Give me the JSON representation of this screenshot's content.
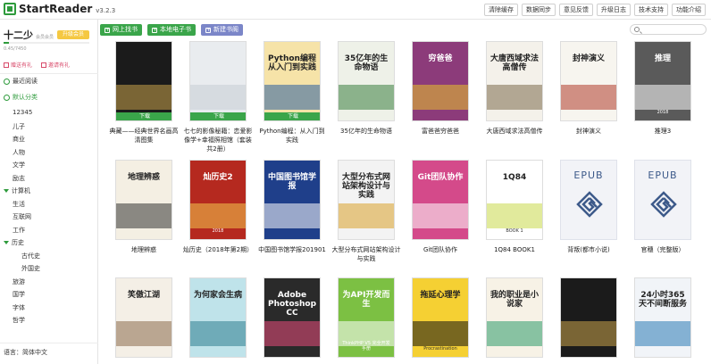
{
  "app": {
    "name": "StartReader",
    "version": "v3.2.3"
  },
  "top_actions": [
    "清除缓存",
    "数据同步",
    "意见反馈",
    "升级日志",
    "技术支持",
    "功能介绍"
  ],
  "user": {
    "name": "十二少",
    "level": "会员会员",
    "upgrade": "升级会员",
    "storage": "0.45/7450",
    "progress": 0.06
  },
  "invites": [
    "赠送有礼",
    "邀请有礼"
  ],
  "nav": {
    "recent": "最近阅读",
    "default_category": "默认分类"
  },
  "categories": [
    {
      "label": "12345",
      "indent": 0,
      "group": false
    },
    {
      "label": "儿子",
      "indent": 0,
      "group": false
    },
    {
      "label": "商业",
      "indent": 0,
      "group": false
    },
    {
      "label": "人物",
      "indent": 0,
      "group": false
    },
    {
      "label": "文学",
      "indent": 0,
      "group": false
    },
    {
      "label": "励志",
      "indent": 0,
      "group": false
    },
    {
      "label": "计算机",
      "indent": 0,
      "group": true
    },
    {
      "label": "生活",
      "indent": 0,
      "group": false
    },
    {
      "label": "互联网",
      "indent": 0,
      "group": false
    },
    {
      "label": "工作",
      "indent": 0,
      "group": false
    },
    {
      "label": "历史",
      "indent": 0,
      "group": true
    },
    {
      "label": "古代史",
      "indent": 1,
      "group": false
    },
    {
      "label": "外国史",
      "indent": 1,
      "group": false
    },
    {
      "label": "旅游",
      "indent": 0,
      "group": false
    },
    {
      "label": "国学",
      "indent": 0,
      "group": false
    },
    {
      "label": "字体",
      "indent": 0,
      "group": false
    },
    {
      "label": "哲学",
      "indent": 0,
      "group": false
    }
  ],
  "language": "语言：简体中文",
  "toolbar": {
    "online": "网上找书",
    "local": "本地电子书",
    "new_shelf": "新建书阁"
  },
  "search": {
    "placeholder": ""
  },
  "download_label": "下载",
  "books": [
    {
      "title": "典藏——经典世界名画高清图集",
      "cover_title": "",
      "cover_sub": "",
      "bg": "#1b1b1b",
      "accent": "#c9a24a",
      "download": true
    },
    {
      "title": "七七的影像秘籍：恋爱影像学+幸福照相馆（套装共2册）",
      "cover_title": "",
      "cover_sub": "",
      "bg": "#e9ecef",
      "accent": "#c7cdd4",
      "download": true
    },
    {
      "title": "Python编程：从入门到实践",
      "cover_title": "Python编程\n从入门到实践",
      "cover_sub": "",
      "bg": "#f6e3a8",
      "accent": "#2a5f9e",
      "download": true
    },
    {
      "title": "35亿年的生命物语",
      "cover_title": "35亿年的生命物语",
      "cover_sub": "",
      "bg": "#eef1e8",
      "accent": "#3a7d3e",
      "download": false
    },
    {
      "title": "富爸爸穷爸爸",
      "cover_title": "穷爸爸",
      "cover_sub": "",
      "bg": "#8c3b7a",
      "accent": "#e8c22a",
      "download": false
    },
    {
      "title": "大唐西域求法高僧传",
      "cover_title": "大唐西域求法高僧传",
      "cover_sub": "",
      "bg": "#f4f1ea",
      "accent": "#7b6a4a",
      "download": false
    },
    {
      "title": "封神演义",
      "cover_title": "封神演义",
      "cover_sub": "",
      "bg": "#f7f5ef",
      "accent": "#b03a2a",
      "download": false
    },
    {
      "title": "推理3",
      "cover_title": "推理",
      "cover_sub": "2018",
      "bg": "#5a5a5a",
      "accent": "#ffffff",
      "download": false
    },
    {
      "title": "地理辨惑",
      "cover_title": "地理辨惑",
      "cover_sub": "",
      "bg": "#f4efe3",
      "accent": "#333333",
      "download": false
    },
    {
      "title": "灿历史（2018年第2期）",
      "cover_title": "灿历史2",
      "cover_sub": "2018",
      "bg": "#b5291f",
      "accent": "#f2c94c",
      "download": false
    },
    {
      "title": "中国图书馆学报201901",
      "cover_title": "中国图书馆学报",
      "cover_sub": "",
      "bg": "#1f3f8a",
      "accent": "#ffffff",
      "download": false
    },
    {
      "title": "大型分布式网站架构设计与实践",
      "cover_title": "大型分布式网站架构设计与实践",
      "cover_sub": "",
      "bg": "#f3f3f3",
      "accent": "#d8a12a",
      "download": false
    },
    {
      "title": "Git团队协作",
      "cover_title": "Git团队协作",
      "cover_sub": "",
      "bg": "#d44a8a",
      "accent": "#ffffff",
      "download": false
    },
    {
      "title": "1Q84 BOOK1",
      "cover_title": "1Q84",
      "cover_sub": "BOOK 1",
      "bg": "#ffffff",
      "accent": "#c8d84a",
      "download": false
    },
    {
      "title": "背叛(都市小说)",
      "cover_title": "EPUB",
      "cover_sub": "",
      "bg": "#f2f3f7",
      "accent": "#3d5a8a",
      "download": false,
      "epub": true
    },
    {
      "title": "官穗（完整版）",
      "cover_title": "EPUB",
      "cover_sub": "",
      "bg": "#f2f3f7",
      "accent": "#3d5a8a",
      "download": false,
      "epub": true
    },
    {
      "title": "",
      "cover_title": "笑傲江湖",
      "cover_sub": "",
      "bg": "#f4efe6",
      "accent": "#8a6a4a",
      "download": false
    },
    {
      "title": "",
      "cover_title": "为何家会生病",
      "cover_sub": "",
      "bg": "#bfe3ea",
      "accent": "#2d7e8e",
      "download": false
    },
    {
      "title": "",
      "cover_title": "Adobe Photoshop CC",
      "cover_sub": "",
      "bg": "#2a2a2a",
      "accent": "#e84a7a",
      "download": false
    },
    {
      "title": "",
      "cover_title": "为API开发而生",
      "cover_sub": "ThinkPHP V5 完全开发手册",
      "bg": "#7cc043",
      "accent": "#ffffff",
      "download": false
    },
    {
      "title": "",
      "cover_title": "拖延心理学",
      "cover_sub": "Procrastination",
      "bg": "#f5d033",
      "accent": "#111111",
      "download": false
    },
    {
      "title": "",
      "cover_title": "我的职业是小说家",
      "cover_sub": "",
      "bg": "#f7f2e6",
      "accent": "#2e9b6a",
      "download": false
    },
    {
      "title": "",
      "cover_title": "",
      "cover_sub": "",
      "bg": "#1b1b1b",
      "accent": "#c9a24a",
      "download": false
    },
    {
      "title": "",
      "cover_title": "24小时365天不间断服务",
      "cover_sub": "",
      "bg": "#f1f4f8",
      "accent": "#2a7ab5",
      "download": false
    }
  ]
}
